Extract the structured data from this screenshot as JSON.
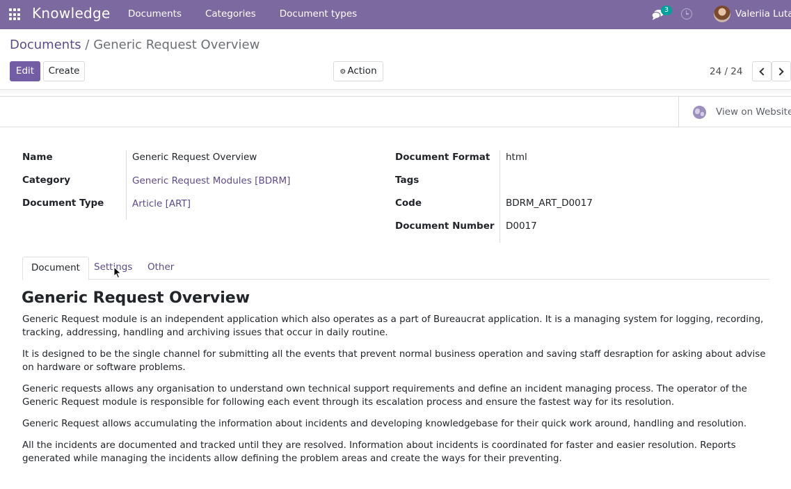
{
  "navbar": {
    "brand": "Knowledge",
    "menu": [
      "Documents",
      "Categories",
      "Document types"
    ],
    "messages_count": "3",
    "user_name": "Valeriia Lutai"
  },
  "control_panel": {
    "breadcrumb_parent": "Documents",
    "breadcrumb_separator": "/",
    "breadcrumb_current": "Generic Request Overview",
    "edit_label": "Edit",
    "create_label": "Create",
    "action_label": "Action",
    "pager": "24 / 24"
  },
  "stat_buttons": {
    "view_on_website": "View on Website"
  },
  "fields_left": [
    {
      "label": "Name",
      "value": "Generic Request Overview"
    },
    {
      "label": "Category",
      "value": "Generic Request Modules [BDRM]"
    },
    {
      "label": "Document Type",
      "value": "Article [ART]"
    }
  ],
  "fields_right": [
    {
      "label": "Document Format",
      "value": "html"
    },
    {
      "label": "Tags",
      "value": ""
    },
    {
      "label": "Code",
      "value": "BDRM_ART_D0017"
    },
    {
      "label": "Document Number",
      "value": "D0017"
    }
  ],
  "tabs": [
    "Document",
    "Settings",
    "Other"
  ],
  "document": {
    "title": "Generic Request Overview",
    "paragraphs": [
      "Generic Request module is an independent application which also operates as a part of Bureaucrat application. It is a managing system for logging, recording, tracking, addressing, handling and archiving issues that occur in daily routine.",
      "It is designed to be the single channel for submitting all the events that prevent normal business operation and saving staff desraption for asking about advise on hardware or software problems.",
      "Generic requests allows any organisation to understand own technical support requirements and define an incident managing process. The operator of the Generic Request module is responsible for following each event through its escalation process and ensure the fastest way for its resolution.",
      "Generic Request allows accumulating the information about incidents and developing knowledgebase for their quick work around, handling and resolution.",
      "All the incidents are documented and tracked until they are resolved. Information about incidents is coordinated for faster and easier resolution. Reports generated while managing the incidents allow defining the problem areas and create the ways for their preventing."
    ]
  },
  "colors": {
    "navbar": "#7b69a0",
    "primary_button": "#735da5",
    "link": "#5d4b8a",
    "badge": "#00a09d"
  }
}
